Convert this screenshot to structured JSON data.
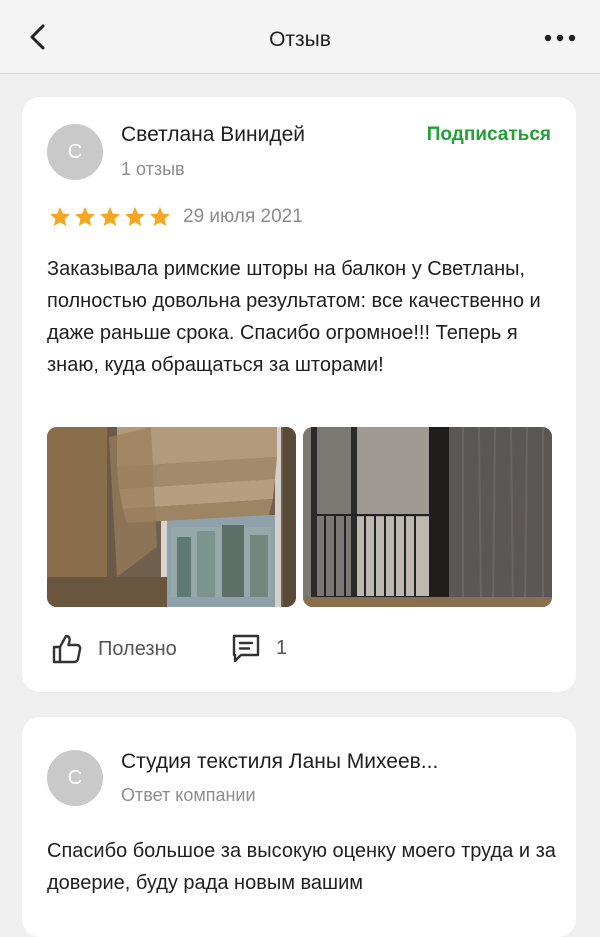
{
  "header": {
    "title": "Отзыв",
    "back_icon": "chevron-left-icon",
    "more_icon": "more-horizontal-icon"
  },
  "review": {
    "avatar_letter": "С",
    "author": "Светлана Винидей",
    "author_meta": "1 отзыв",
    "subscribe_label": "Подписаться",
    "rating": 5,
    "rating_max": 5,
    "date": "29 июля 2021",
    "text": "Заказывала римские шторы на балкон у Светланы, полностью довольна результатом: все качественно и даже раньше срока. Спасибо огромное!!! Теперь я знаю, куда обращаться за шторами!",
    "photos": [
      "photo-roman-blinds",
      "photo-balcony-curtains"
    ],
    "helpful_label": "Полезно",
    "comments_count": "1"
  },
  "reply": {
    "avatar_letter": "С",
    "author": "Студия текстиля Ланы Михеев...",
    "author_meta": "Ответ компании",
    "text": "Спасибо большое за высокую оценку моего труда и за доверие, буду рада новым вашим"
  },
  "colors": {
    "accent": "#21a038",
    "star": "#f5a623",
    "avatar_bg": "#c9c9c9",
    "background": "#efefef",
    "muted_text": "#8c8c8c"
  }
}
